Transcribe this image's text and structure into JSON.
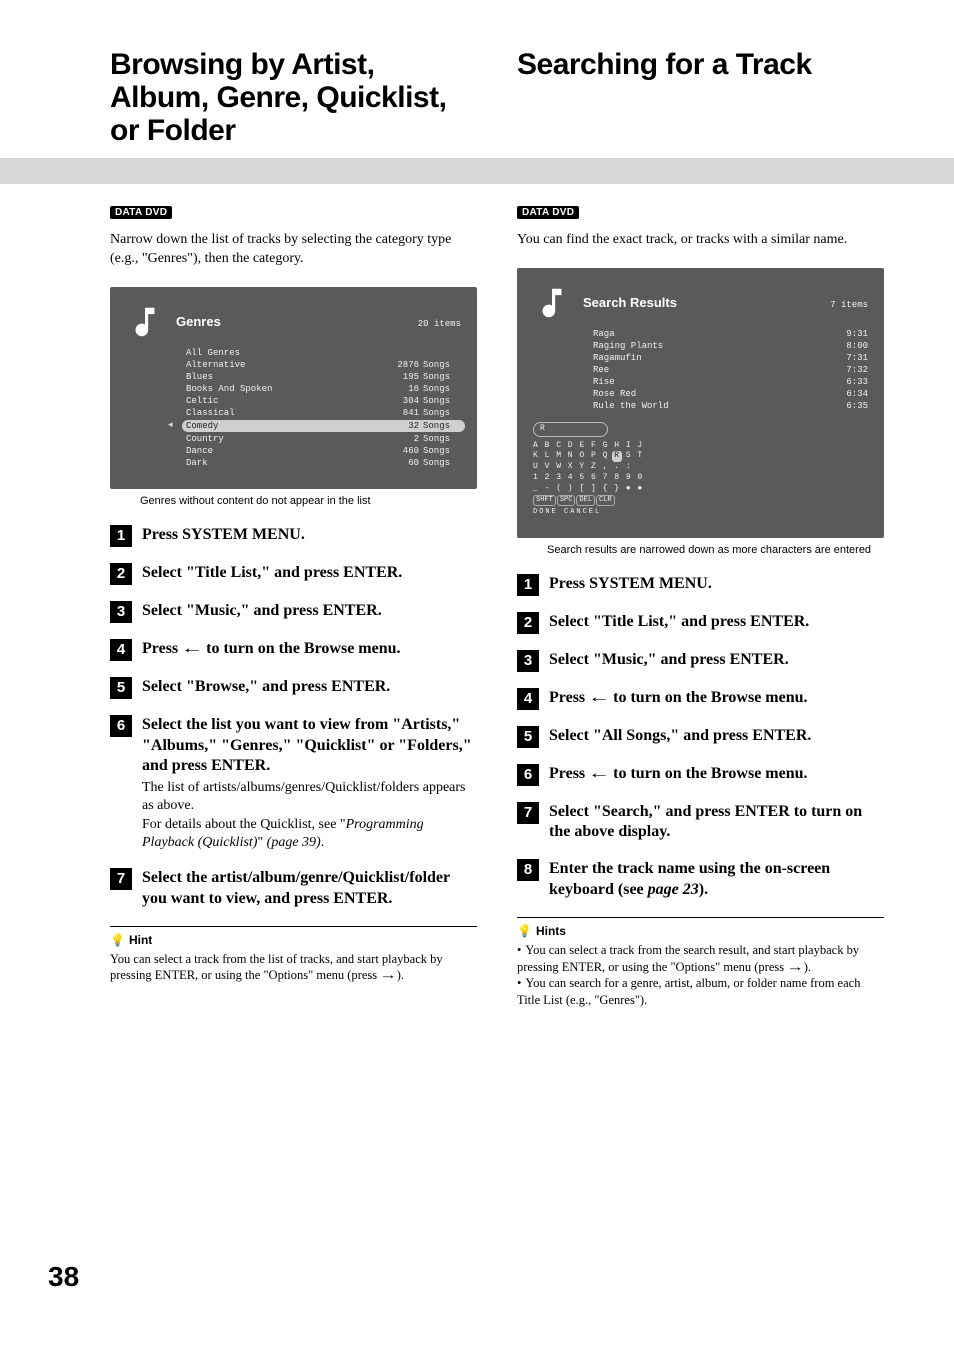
{
  "page_number": "38",
  "left": {
    "heading": "Browsing by Artist, Album, Genre, Quicklist, or Folder",
    "badge": "DATA DVD",
    "lead": "Narrow down the list of tracks by selecting the category type (e.g., \"Genres\"), then the category.",
    "osd": {
      "title": "Genres",
      "count": "20 items",
      "rows": [
        {
          "name": "All Genres",
          "val": "",
          "unit": ""
        },
        {
          "name": "Alternative",
          "val": "2876",
          "unit": "Songs"
        },
        {
          "name": "Blues",
          "val": "195",
          "unit": "Songs"
        },
        {
          "name": "Books And Spoken",
          "val": "16",
          "unit": "Songs"
        },
        {
          "name": "Celtic",
          "val": "304",
          "unit": "Songs"
        },
        {
          "name": "Classical",
          "val": "841",
          "unit": "Songs"
        },
        {
          "name": "Comedy",
          "val": "32",
          "unit": "Songs",
          "sel": true
        },
        {
          "name": "Country",
          "val": "2",
          "unit": "Songs"
        },
        {
          "name": "Dance",
          "val": "460",
          "unit": "Songs"
        },
        {
          "name": "Dark",
          "val": "60",
          "unit": "Songs"
        }
      ]
    },
    "osd_caption": "Genres without content do not appear in the list",
    "steps": [
      {
        "n": "1",
        "t": "Press SYSTEM MENU."
      },
      {
        "n": "2",
        "t": "Select \"Title List,\" and press ENTER."
      },
      {
        "n": "3",
        "t": "Select \"Music,\" and press ENTER."
      },
      {
        "n": "4",
        "t": "Press ← to turn on the Browse menu.",
        "arrow": true
      },
      {
        "n": "5",
        "t": "Select \"Browse,\" and press ENTER."
      },
      {
        "n": "6",
        "t": "Select the list you want to view from \"Artists,\" \"Albums,\" \"Genres,\" \"Quicklist\" or \"Folders,\" and press ENTER.",
        "sub": "The list of artists/albums/genres/Quicklist/folders appears as above.\nFor details about the Quicklist, see \"<em>Programming Playback (Quicklist)</em>\" <em>(page 39)</em>."
      },
      {
        "n": "7",
        "t": "Select the artist/album/genre/Quicklist/folder you want to view, and press ENTER."
      }
    ],
    "hint_title": "Hint",
    "hint_text": "You can select a track from the list of tracks, and start playback by pressing ENTER, or using the \"Options\" menu (press →)."
  },
  "right": {
    "heading": "Searching for a Track",
    "badge": "DATA DVD",
    "lead": "You can find the exact track, or tracks with a similar name.",
    "osd": {
      "title": "Search Results",
      "count": "7 items",
      "rows": [
        {
          "t": "Raga",
          "d": "9:31"
        },
        {
          "t": "Raging Plants",
          "d": "8:00"
        },
        {
          "t": "Ragamufin",
          "d": "7:31"
        },
        {
          "t": "Ree",
          "d": "7:32"
        },
        {
          "t": "Rise",
          "d": "6:33"
        },
        {
          "t": "Rose Red",
          "d": "6:34"
        },
        {
          "t": "Rule the World",
          "d": "6:35"
        }
      ],
      "input": "R",
      "kb1": "A B C D E F G H I J",
      "kb2_pre": "K L M N O P Q ",
      "kb2_hi": "R",
      "kb2_post": " S T",
      "kb3": "U V W X Y Z , . :",
      "kb4": "1 2 3 4 5 6 7 8 9 0",
      "kb5": "_ - ( ) [ ] { } ● ●",
      "btns": [
        "SHFT",
        "SPC",
        "DEL",
        "CLR"
      ],
      "dc": "DONE   CANCEL"
    },
    "osd_caption": "Search results are narrowed down as more characters are entered",
    "steps": [
      {
        "n": "1",
        "t": "Press SYSTEM MENU."
      },
      {
        "n": "2",
        "t": "Select \"Title List,\" and press ENTER."
      },
      {
        "n": "3",
        "t": "Select \"Music,\" and press ENTER."
      },
      {
        "n": "4",
        "t": "Press ← to turn on the Browse menu.",
        "arrow": true
      },
      {
        "n": "5",
        "t": "Select \"All Songs,\" and press ENTER."
      },
      {
        "n": "6",
        "t": "Press ← to turn on the Browse menu.",
        "arrow": true
      },
      {
        "n": "7",
        "t": "Select \"Search,\" and press ENTER to turn on the above display."
      },
      {
        "n": "8",
        "t": "Enter the track name using the on-screen keyboard (see <em>page 23</em>)."
      }
    ],
    "hint_title": "Hints",
    "hints": [
      "You can select a track from the search result, and start playback by pressing ENTER, or using the \"Options\" menu (press →).",
      "You can search for a genre, artist, album, or folder name from each Title List (e.g., \"Genres\")."
    ]
  }
}
